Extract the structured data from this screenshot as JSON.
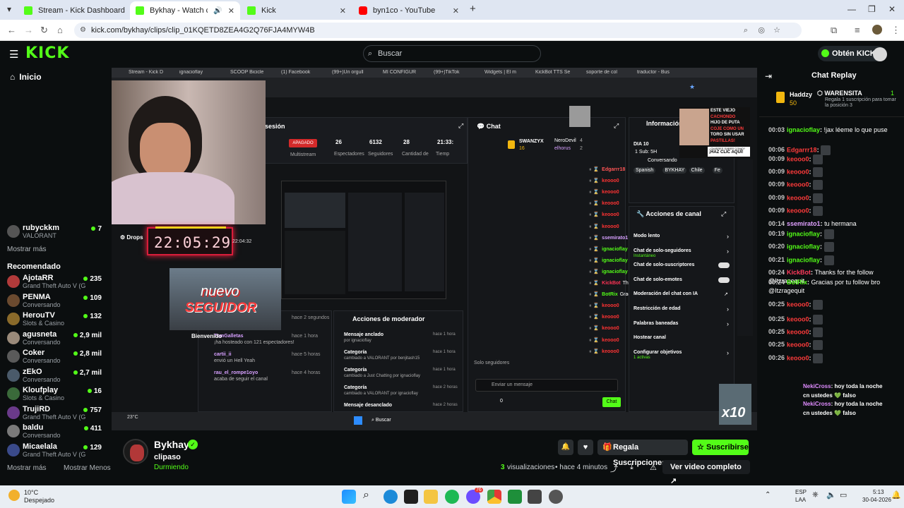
{
  "browser": {
    "tabs": [
      {
        "title": "Stream - Kick Dashboard",
        "active": false,
        "color": "#53fc18"
      },
      {
        "title": "Bykhay - Watch clips on Kick",
        "active": true,
        "color": "#53fc18"
      },
      {
        "title": "Kick",
        "active": false,
        "color": "#53fc18"
      },
      {
        "title": "byn1co - YouTube",
        "active": false,
        "color": "#ff0000"
      }
    ],
    "url": "kick.com/bykhay/clips/clip_01KQETD8ZEA4G2Q76FJA4MYW4B"
  },
  "header": {
    "logo": "KICK",
    "search_placeholder": "Buscar",
    "get_kicks": "Obtén KICKs"
  },
  "sidebar": {
    "home": "Inicio",
    "followed_partial": {
      "name": "rubyckkm",
      "game": "VALORANT",
      "viewers": "7"
    },
    "show_more": "Mostrar más",
    "recommended_title": "Recomendado",
    "recommended": [
      {
        "name": "AjotaRR",
        "game": "Grand Theft Auto V (G...",
        "viewers": "235",
        "color": "#b23a3a"
      },
      {
        "name": "PENMA",
        "game": "Conversando",
        "viewers": "109",
        "color": "#6b4a2f"
      },
      {
        "name": "HerouTV",
        "game": "Slots & Casino",
        "viewers": "132",
        "color": "#8a6a2a"
      },
      {
        "name": "agusneta",
        "game": "Conversando",
        "viewers": "2,9 mil",
        "color": "#9a8a7a"
      },
      {
        "name": "Coker",
        "game": "Conversando",
        "viewers": "2,8 mil",
        "color": "#5a5a5a"
      },
      {
        "name": "zEkO",
        "game": "Conversando",
        "viewers": "2,7 mil",
        "color": "#4a5a6a"
      },
      {
        "name": "Kloufplay",
        "game": "Slots & Casino",
        "viewers": "16",
        "color": "#3a6a3a"
      },
      {
        "name": "TrujiRD",
        "game": "Grand Theft Auto V (G...",
        "viewers": "757",
        "color": "#6a3a8a"
      },
      {
        "name": "baldu",
        "game": "Conversando",
        "viewers": "411",
        "color": "#7a7a7a"
      },
      {
        "name": "Micaelala",
        "game": "Grand Theft Auto V (G...",
        "viewers": "129",
        "color": "#3a4a8a"
      }
    ],
    "show_more_2": "Mostrar más",
    "show_less": "Mostrar Menos"
  },
  "clip": {
    "channel": "Bykhay",
    "title": "clipaso",
    "status": "Durmiendo",
    "views_count": "3",
    "views_label": "visualizaciones",
    "age": "hace 4 minutos",
    "gift_button": "Regala Suscripciones",
    "subscribe_button": "Suscribirse",
    "full_video_button": "Ver video completo"
  },
  "stream_overlay": {
    "clock": "22:05:29",
    "new_follower_line1": "nuevo",
    "new_follower_line2": "SEGUIDOR",
    "banner_lines": [
      "ESTE VIEJO",
      "CACHONDO",
      "HIJO DE PUTA",
      "COJE COMO UN",
      "TORO SIN USAR",
      "PASTILLAS!"
    ],
    "banner_cta_small": "¿QUIERES SABER COMO?",
    "banner_cta": "¡HAZ CLIC AQUÍ!",
    "x10": "x10",
    "drops": "Drops"
  },
  "inner_screen": {
    "tabs": [
      "Stream - Kick D",
      "ignacioflay",
      "SCOOP Bicicle",
      "(1) Facebook",
      "(99+)Un orgull",
      "MI CONFIGUR",
      "(99+)TikTok",
      "Widgets | El m",
      "KickBot TTS Se",
      "soporte de col",
      "traductor - Bus"
    ],
    "session_title": "sesión",
    "offline_badge": "APAGADO",
    "multistream": "Multistream",
    "stats": [
      {
        "value": "26",
        "label": "Espectadores"
      },
      {
        "value": "6132",
        "label": "Seguidores"
      },
      {
        "value": "28",
        "label": "Cantidad de"
      },
      {
        "value": "21:33:",
        "label": "Tiemp"
      }
    ],
    "chat_title": "Chat",
    "top_gifter": {
      "name": "SWANZYX",
      "count": "16"
    },
    "top2": {
      "name": "NeroDevil",
      "count": "4"
    },
    "top3": {
      "name": "elhorus",
      "count": "2"
    },
    "chat_rows": [
      {
        "user": "Edgarrr18",
        "text": "",
        "color": "#ff5555"
      },
      {
        "user": "keooo0",
        "text": "",
        "color": "#ff3333"
      },
      {
        "user": "keooo0",
        "text": "",
        "color": "#ff3333"
      },
      {
        "user": "keooo0",
        "text": "",
        "color": "#ff3333"
      },
      {
        "user": "keooo0",
        "text": "",
        "color": "#ff3333"
      },
      {
        "user": "keooo0",
        "text": "",
        "color": "#ff3333"
      },
      {
        "user": "ssemirato1",
        "text": "tu hermana",
        "color": "#d7a0ff"
      },
      {
        "user": "ignacioflay",
        "text": "",
        "color": "#53fc18"
      },
      {
        "user": "ignacioflay",
        "text": "",
        "color": "#53fc18"
      },
      {
        "user": "ignacioflay",
        "text": "",
        "color": "#53fc18"
      },
      {
        "user": "KickBot",
        "text": "Thanks for the follow @Itzragequit",
        "color": "#ff3355"
      },
      {
        "user": "BotRix",
        "text": "Gracias por tu follow bro @Itzragequit",
        "color": "#53fc18"
      },
      {
        "user": "keooo0",
        "text": "",
        "color": "#ff3333"
      },
      {
        "user": "keooo0",
        "text": "",
        "color": "#ff3333"
      },
      {
        "user": "keooo0",
        "text": "",
        "color": "#ff3333"
      },
      {
        "user": "keooo0",
        "text": "",
        "color": "#ff3333"
      },
      {
        "user": "keooo0",
        "text": "",
        "color": "#ff3333"
      }
    ],
    "followers_only_label": "Solo seguidores",
    "send_placeholder": "Enviar un mensaje",
    "chat_button": "Chat",
    "chat_count": "0",
    "info_title": "Información del stream",
    "info_day": "DIA 10",
    "info_sub": "1 Sub: 5H",
    "info_conv": "Conversando",
    "info_tags": [
      "Spanish",
      "BYKHAY",
      "Chile",
      "Fe"
    ],
    "actions_title": "Acciones de canal",
    "actions": [
      {
        "label": "Modo lento",
        "kind": "chevron"
      },
      {
        "label": "Chat de solo-seguidores",
        "sub": "Instantáneo",
        "kind": "chevron"
      },
      {
        "label": "Chat de solo-suscriptores",
        "kind": "toggle"
      },
      {
        "label": "Chat de solo-emotes",
        "kind": "toggle"
      },
      {
        "label": "Moderación del chat con IA",
        "kind": "ext"
      },
      {
        "label": "Restricción de edad",
        "kind": "chevron"
      },
      {
        "label": "Palabras baneadas",
        "kind": "chevron"
      },
      {
        "label": "Hostear canal",
        "kind": "none"
      },
      {
        "label": "Configurar objetivos",
        "sub": "1 activas",
        "kind": "chevron"
      }
    ],
    "feed": [
      {
        "user": "Itzragequit",
        "text": "acaba de seguir el canal",
        "time": "hace 2 segundos"
      },
      {
        "user": "TomGalletas",
        "text": "¡ha hosteado con 121 espectadores!",
        "time": "hace 1 hora"
      },
      {
        "user": "cartii_ii",
        "text": "envió un Hell Yeah",
        "time": "hace 5 horas"
      },
      {
        "user": "rau_el_rompe1oyo",
        "text": "acaba de seguir el canal",
        "time": "hace 4 horas"
      }
    ],
    "feed_welcome": "Bienvenido",
    "mod_title": "Acciones de moderador",
    "mod_items": [
      {
        "title": "Mensaje anclado",
        "sub": "por ignacioflay",
        "time": "hace 1 hora"
      },
      {
        "title": "Categoría",
        "sub": "cambiado a VALORANT por benjitash15",
        "time": "hace 1 hora"
      },
      {
        "title": "Categoría",
        "sub": "cambiado a Just Chatting por ignacioflay",
        "time": "hace 1 hora"
      },
      {
        "title": "Categoría",
        "sub": "cambiado a VALORANT por ignacioflay",
        "time": "hace 2 horas"
      },
      {
        "title": "Mensaje desanclado",
        "sub": "",
        "time": "hace 2 horas"
      }
    ],
    "pip_time": "22:04:32",
    "taskbar_search": "Buscar",
    "taskbar_lang": "ESP\nLAA",
    "taskbar_date": "30-04-2026",
    "weather": "23°C"
  },
  "replay": {
    "title": "Chat Replay",
    "gifter_name": "Haddzy",
    "gifter_count": "50",
    "pinned_user": "WARENSITA",
    "pinned_count": "1",
    "pinned_text": "Regala 1 suscripción para tomar la posición 3",
    "messages": [
      {
        "time": "00:03",
        "user": "ignacioflay",
        "text": "!jax léeme lo que puse",
        "color": "#53fc18",
        "emote": false
      },
      {
        "time": "00:06",
        "user": "Edgarrr18",
        "text": "",
        "color": "#ff3b3b",
        "emote": true
      },
      {
        "time": "00:09",
        "user": "keooo0",
        "text": "",
        "color": "#ff3b3b",
        "emote": true
      },
      {
        "time": "00:09",
        "user": "keooo0",
        "text": "",
        "color": "#ff3b3b",
        "emote": true
      },
      {
        "time": "00:09",
        "user": "keooo0",
        "text": "",
        "color": "#ff3b3b",
        "emote": true
      },
      {
        "time": "00:09",
        "user": "keooo0",
        "text": "",
        "color": "#ff3b3b",
        "emote": true
      },
      {
        "time": "00:09",
        "user": "keooo0",
        "text": "",
        "color": "#ff3b3b",
        "emote": true
      },
      {
        "time": "00:14",
        "user": "ssemirato1",
        "text": "tu hermana",
        "color": "#e0a0ff",
        "emote": false
      },
      {
        "time": "00:19",
        "user": "ignacioflay",
        "text": "",
        "color": "#53fc18",
        "emote": true
      },
      {
        "time": "00:20",
        "user": "ignacioflay",
        "text": "",
        "color": "#53fc18",
        "emote": true
      },
      {
        "time": "00:21",
        "user": "ignacioflay",
        "text": "",
        "color": "#53fc18",
        "emote": true
      },
      {
        "time": "00:24",
        "user": "KickBot",
        "text": "Thanks for the follow @Itzragequit",
        "color": "#ff3b5c",
        "emote": false
      },
      {
        "time": "00:24",
        "user": "BotRix",
        "text": "Gracias por tu follow bro @Itzragequit",
        "color": "#53fc18",
        "emote": false
      },
      {
        "time": "00:25",
        "user": "keooo0",
        "text": "",
        "color": "#ff3b3b",
        "emote": true
      },
      {
        "time": "00:25",
        "user": "keooo0",
        "text": "",
        "color": "#ff3b3b",
        "emote": true
      },
      {
        "time": "00:25",
        "user": "keooo0",
        "text": "",
        "color": "#ff3b3b",
        "emote": true
      },
      {
        "time": "00:25",
        "user": "keooo0",
        "text": "",
        "color": "#ff3b3b",
        "emote": true
      },
      {
        "time": "00:26",
        "user": "keooo0",
        "text": "",
        "color": "#ff3b3b",
        "emote": true
      }
    ],
    "overlay_lines": [
      {
        "user": "NekiCross",
        "text": ": hoy toda la noche"
      },
      {
        "user": "",
        "text": "cn ustedes 💚 falso"
      },
      {
        "user": "NekiCross",
        "text": ": hoy toda la noche"
      },
      {
        "user": "",
        "text": "cn ustedes 💚 falso"
      }
    ]
  },
  "taskbar": {
    "weather_temp": "10°C",
    "weather_desc": "Despejado",
    "lang": "ESP",
    "region": "LAA",
    "time": "5:13",
    "date": "30-04-2026",
    "badge_1": "76"
  },
  "colors": {
    "accent": "#53fc18",
    "bg": "#0b0e0f",
    "panel": "#191b1f"
  }
}
